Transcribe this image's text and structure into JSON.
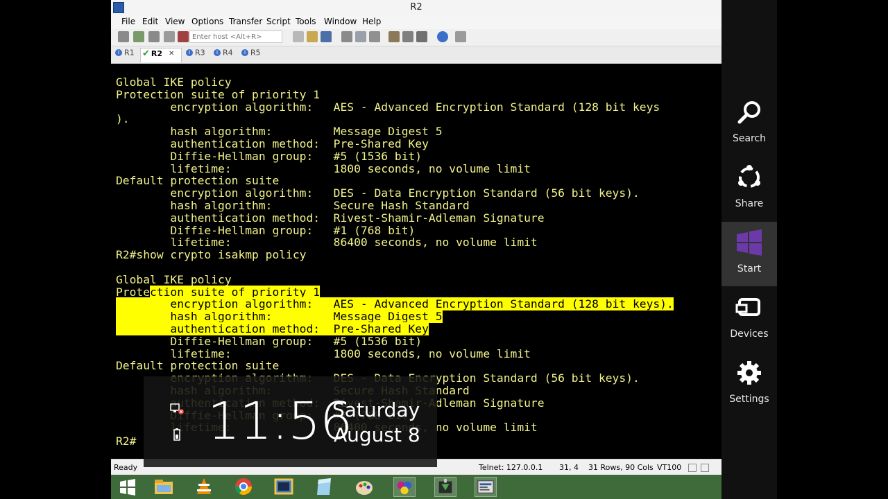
{
  "window": {
    "title": "R2",
    "menu": [
      "File",
      "Edit",
      "View",
      "Options",
      "Transfer",
      "Script",
      "Tools",
      "Window",
      "Help"
    ],
    "host_placeholder": "Enter host <Alt+R>",
    "tabs": [
      {
        "label": "R1",
        "status": "info"
      },
      {
        "label": "R2",
        "status": "connected",
        "close": "✕"
      },
      {
        "label": "R3",
        "status": "info"
      },
      {
        "label": "R4",
        "status": "info"
      },
      {
        "label": "R5",
        "status": "info"
      }
    ]
  },
  "terminal": {
    "lines": [
      "Global IKE policy",
      "Protection suite of priority 1",
      "        encryption algorithm:   AES - Advanced Encryption Standard (128 bit keys",
      ").",
      "        hash algorithm:         Message Digest 5",
      "        authentication method:  Pre-Shared Key",
      "        Diffie-Hellman group:   #5 (1536 bit)",
      "        lifetime:               1800 seconds, no volume limit",
      "Default protection suite",
      "        encryption algorithm:   DES - Data Encryption Standard (56 bit keys).",
      "        hash algorithm:         Secure Hash Standard",
      "        authentication method:  Rivest-Shamir-Adleman Signature",
      "        Diffie-Hellman group:   #1 (768 bit)",
      "        lifetime:               86400 seconds, no volume limit",
      "R2#show crypto isakmp policy",
      "",
      "Global IKE policy",
      "Protection suite of priority 1",
      "        encryption algorithm:   AES - Advanced Encryption Standard (128 bit keys).",
      "        hash algorithm:         Message Digest 5",
      "        authentication method:  Pre-Shared Key",
      "        Diffie-Hellman group:   #5 (1536 bit)",
      "        lifetime:               1800 seconds, no volume limit",
      "Default protection suite",
      "        encryption algorithm:   DES - Data Encryption Standard (56 bit keys).",
      "        hash algorithm:         Secure Hash Standard",
      "        authentication method:  Rivest-Shamir-Adleman Signature",
      "        Diffie-Hellman group:   #1 (768 bit)",
      "        lifetime:               86400 seconds, no volume limit"
    ],
    "prompt": "R2#",
    "text_color": "#f2f28a",
    "highlight_color": "#ffff00"
  },
  "status": {
    "ready": "Ready",
    "telnet": "Telnet: 127.0.0.1",
    "cursor": "31,  4",
    "size": "31 Rows, 90 Cols",
    "emulation": "VT100"
  },
  "lock_overlay": {
    "time": "11:56",
    "day": "Saturday",
    "date": "August 8"
  },
  "charms": [
    {
      "label": "Search",
      "icon": "search-icon"
    },
    {
      "label": "Share",
      "icon": "share-icon"
    },
    {
      "label": "Start",
      "icon": "windows-logo-icon"
    },
    {
      "label": "Devices",
      "icon": "devices-icon"
    },
    {
      "label": "Settings",
      "icon": "gear-icon"
    }
  ],
  "taskbar": {
    "apps": [
      "start-button",
      "file-explorer-icon",
      "vlc-icon",
      "chrome-icon",
      "putty-icon",
      "notepad-icon",
      "paint-icon",
      "gns3-icon",
      "wireshark-icon",
      "securecrt-icon"
    ]
  }
}
